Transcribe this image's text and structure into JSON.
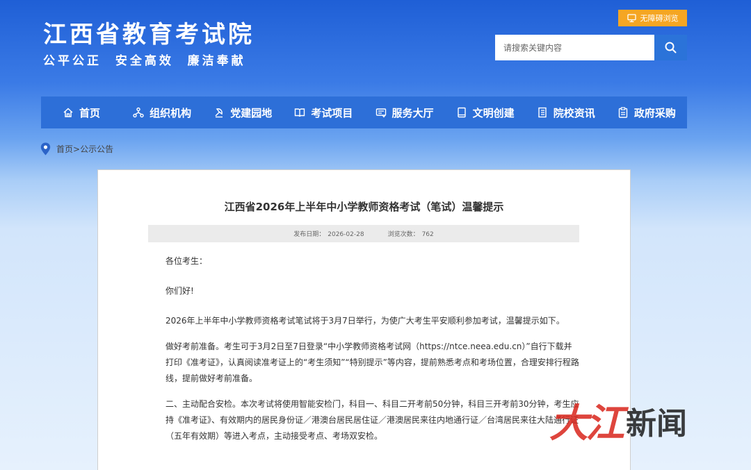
{
  "header": {
    "site_title": "江西省教育考试院",
    "slogan": "公平公正  安全高效  廉洁奉献",
    "accessibility_label": "无障碍浏览",
    "search_placeholder": "请搜索关键内容",
    "search_icon": "search-icon"
  },
  "nav": {
    "items": [
      {
        "label": "首页",
        "icon": "home-icon"
      },
      {
        "label": "组织机构",
        "icon": "org-icon"
      },
      {
        "label": "党建园地",
        "icon": "party-icon"
      },
      {
        "label": "考试项目",
        "icon": "book-icon"
      },
      {
        "label": "服务大厅",
        "icon": "service-icon"
      },
      {
        "label": "文明创建",
        "icon": "doc-icon"
      },
      {
        "label": "院校资讯",
        "icon": "news-icon"
      },
      {
        "label": "政府采购",
        "icon": "clipboard-icon"
      }
    ]
  },
  "breadcrumb": {
    "home": "首页",
    "separator": ">",
    "current": "公示公告"
  },
  "article": {
    "title": "江西省2026年上半年中小学教师资格考试（笔试）温馨提示",
    "date_label": "发布日期：",
    "date": "2026-02-28",
    "views_label": "浏览次数：",
    "views": "762",
    "greeting": "各位考生：",
    "hello": "你们好!",
    "intro": "2026年上半年中小学教师资格考试笔试将于3月7日举行，为使广大考生平安顺利参加考试，温馨提示如下。",
    "para1": "做好考前准备。考生可于3月2日至7日登录“中小学教师资格考试网（https://ntce.neea.edu.cn）”自行下载并打印《准考证》，认真阅读准考证上的“考生须知”“特别提示”等内容，提前熟悉考点和考场位置，合理安排行程路线，提前做好考前准备。",
    "para2": "二、主动配合安检。本次考试将使用智能安检门，科目一、科目二开考前50分钟，科目三开考前30分钟，考生应持《准考证》、有效期内的居民身份证／港澳台居民居住证／港澳居民来往内地通行证／台湾居民来往大陆通行证（五年有效期）等进入考点，主动接受考点、考场双安检。"
  },
  "watermark": {
    "red": "大江",
    "black": "新闻"
  },
  "colors": {
    "nav_bg": "#2d6fd8",
    "access_bg": "#f5a623",
    "search_btn_bg": "#2b73d9",
    "watermark_red": "#d9251c"
  }
}
